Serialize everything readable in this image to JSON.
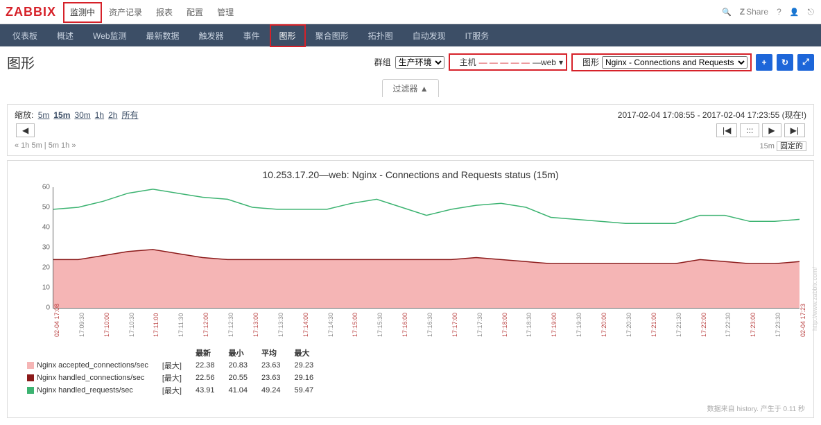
{
  "topnav": {
    "logo": "ZABBIX",
    "items": [
      "监测中",
      "资产记录",
      "报表",
      "配置",
      "管理"
    ],
    "active_index": 0,
    "share_label": "Share"
  },
  "subnav": {
    "items": [
      "仪表板",
      "概述",
      "Web监测",
      "最新数据",
      "触发器",
      "事件",
      "图形",
      "聚合图形",
      "拓扑图",
      "自动发现",
      "IT服务"
    ],
    "active_index": 6
  },
  "page": {
    "title": "图形",
    "group_label": "群组",
    "group_value": "生产环境",
    "host_label": "主机",
    "host_value_masked": "— — — — —",
    "host_suffix": "—web",
    "graph_label": "图形",
    "graph_value": "Nginx - Connections and Requests status"
  },
  "filter_tab": "过滤器 ▲",
  "time": {
    "zoom_label": "缩放:",
    "zoom_options": [
      "5m",
      "15m",
      "30m",
      "1h",
      "2h",
      "所有"
    ],
    "zoom_selected": "15m",
    "range_from": "2017-02-04 17:08:55",
    "range_to": "2017-02-04 17:23:55 (现在!)",
    "nav_left_links": "«  1h  5m  |  5m  1h  »",
    "duration": "15m",
    "fixed_label": "固定的",
    "nav_dots": ":::"
  },
  "chart_data": {
    "type": "line",
    "title": "10.253.17.20—web: Nginx - Connections and Requests status (15m)",
    "ylim": [
      0,
      60
    ],
    "yticks": [
      0,
      10,
      20,
      30,
      40,
      50,
      60
    ],
    "xticks": [
      {
        "label": "02-04 17:08",
        "major": true
      },
      {
        "label": "17:09:30",
        "major": false
      },
      {
        "label": "17:10:00",
        "major": true
      },
      {
        "label": "17:10:30",
        "major": false
      },
      {
        "label": "17:11:00",
        "major": true
      },
      {
        "label": "17:11:30",
        "major": false
      },
      {
        "label": "17:12:00",
        "major": true
      },
      {
        "label": "17:12:30",
        "major": false
      },
      {
        "label": "17:13:00",
        "major": true
      },
      {
        "label": "17:13:30",
        "major": false
      },
      {
        "label": "17:14:00",
        "major": true
      },
      {
        "label": "17:14:30",
        "major": false
      },
      {
        "label": "17:15:00",
        "major": true
      },
      {
        "label": "17:15:30",
        "major": false
      },
      {
        "label": "17:16:00",
        "major": true
      },
      {
        "label": "17:16:30",
        "major": false
      },
      {
        "label": "17:17:00",
        "major": true
      },
      {
        "label": "17:17:30",
        "major": false
      },
      {
        "label": "17:18:00",
        "major": true
      },
      {
        "label": "17:18:30",
        "major": false
      },
      {
        "label": "17:19:00",
        "major": true
      },
      {
        "label": "17:19:30",
        "major": false
      },
      {
        "label": "17:20:00",
        "major": true
      },
      {
        "label": "17:20:30",
        "major": false
      },
      {
        "label": "17:21:00",
        "major": true
      },
      {
        "label": "17:21:30",
        "major": false
      },
      {
        "label": "17:22:00",
        "major": true
      },
      {
        "label": "17:22:30",
        "major": false
      },
      {
        "label": "17:23:00",
        "major": true
      },
      {
        "label": "17:23:30",
        "major": false
      },
      {
        "label": "02-04 17:23",
        "major": true
      }
    ],
    "series": [
      {
        "name": "Nginx accepted_connections/sec",
        "type": "area",
        "color": "#f5b5b5",
        "agg": "[最大]",
        "last": 22.38,
        "min": 20.83,
        "avg": 23.63,
        "max": 29.23,
        "values": [
          24,
          24,
          26,
          28,
          29,
          27,
          25,
          24,
          24,
          24,
          24,
          24,
          24,
          24,
          24,
          24,
          24,
          25,
          24,
          23,
          22,
          22,
          22,
          22,
          22,
          22,
          24,
          23,
          22,
          22,
          23
        ]
      },
      {
        "name": "Nginx handled_connections/sec",
        "type": "line",
        "color": "#8b1a1a",
        "agg": "[最大]",
        "last": 22.56,
        "min": 20.55,
        "avg": 23.63,
        "max": 29.16,
        "values": [
          24,
          24,
          26,
          28,
          29,
          27,
          25,
          24,
          24,
          24,
          24,
          24,
          24,
          24,
          24,
          24,
          24,
          25,
          24,
          23,
          22,
          22,
          22,
          22,
          22,
          22,
          24,
          23,
          22,
          22,
          23
        ]
      },
      {
        "name": "Nginx handled_requests/sec",
        "type": "line",
        "color": "#3cb371",
        "agg": "[最大]",
        "last": 43.91,
        "min": 41.04,
        "avg": 49.24,
        "max": 59.47,
        "values": [
          49,
          50,
          53,
          57,
          59,
          57,
          55,
          54,
          50,
          49,
          49,
          49,
          52,
          54,
          50,
          46,
          49,
          51,
          52,
          50,
          45,
          44,
          43,
          42,
          42,
          42,
          46,
          46,
          43,
          43,
          44
        ]
      }
    ],
    "legend_headers": [
      "最新",
      "最小",
      "平均",
      "最大"
    ]
  },
  "footer_note": "数据来自 history. 产生于 0.11 秒",
  "watermark": "http://www.zabbix.com/"
}
